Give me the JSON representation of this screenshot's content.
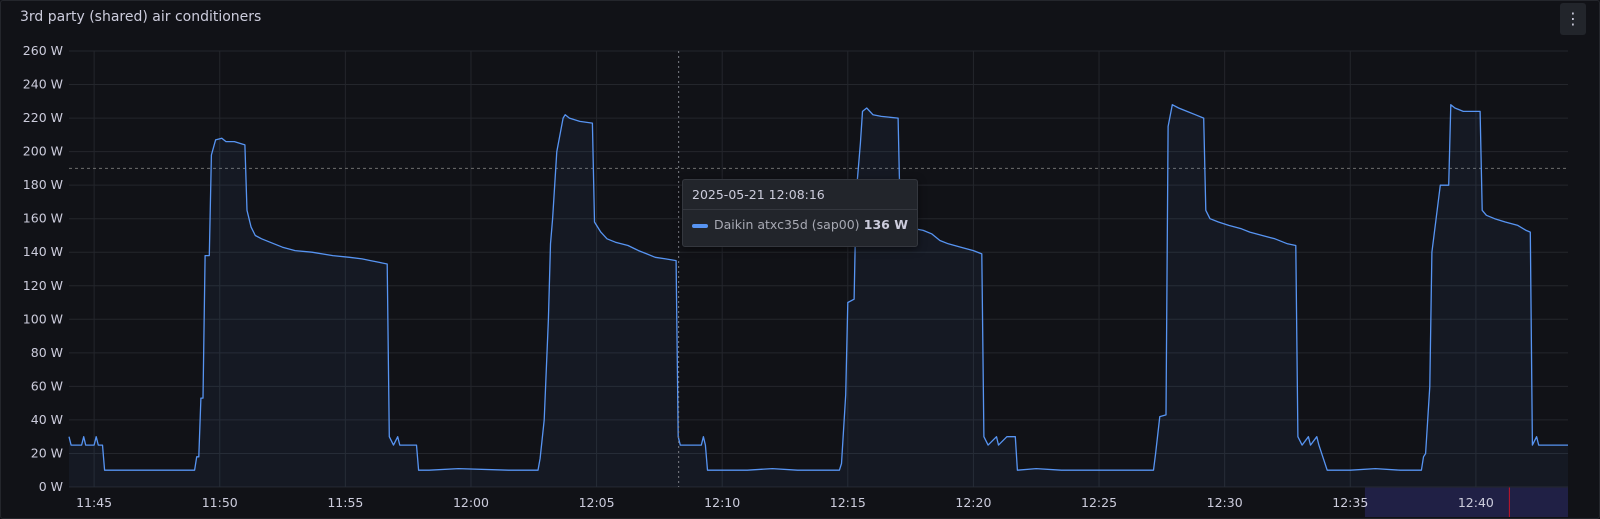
{
  "panel": {
    "title": "3rd party (shared) air conditioners",
    "menu_icon": "⋮"
  },
  "tooltip": {
    "time": "2025-05-21 12:08:16",
    "series": "Daikin atxc35d (sap00)",
    "value": "136 W"
  },
  "colors": {
    "series": "#5794f2",
    "background": "#111217",
    "grid": "#24262c",
    "threshold": "#6e6e6e",
    "range_highlight": "#2e2b6b",
    "now_marker": "#c4162a"
  },
  "chart_data": {
    "type": "line",
    "title": "3rd party (shared) air conditioners",
    "xlabel": "",
    "ylabel": "",
    "ylim": [
      0,
      260
    ],
    "yticks": [
      "0 W",
      "20 W",
      "40 W",
      "60 W",
      "80 W",
      "100 W",
      "120 W",
      "140 W",
      "160 W",
      "180 W",
      "200 W",
      "220 W",
      "240 W",
      "260 W"
    ],
    "xticks": [
      "11:45",
      "11:50",
      "11:55",
      "12:00",
      "12:05",
      "12:10",
      "12:15",
      "12:20",
      "12:25",
      "12:30",
      "12:35",
      "12:40"
    ],
    "xlim": [
      "11:44:00",
      "12:43:40"
    ],
    "threshold": 190,
    "cursor_time": "12:08:16",
    "grid": true,
    "legend": "none",
    "series": [
      {
        "name": "Daikin atxc35d (sap00)",
        "fill": true,
        "points": [
          [
            "11:44:00",
            30
          ],
          [
            "11:44:05",
            25
          ],
          [
            "11:44:30",
            25
          ],
          [
            "11:44:35",
            30
          ],
          [
            "11:44:40",
            25
          ],
          [
            "11:45:00",
            25
          ],
          [
            "11:45:05",
            30
          ],
          [
            "11:45:10",
            25
          ],
          [
            "11:45:20",
            25
          ],
          [
            "11:45:25",
            10
          ],
          [
            "11:49:00",
            10
          ],
          [
            "11:49:05",
            18
          ],
          [
            "11:49:10",
            18
          ],
          [
            "11:49:15",
            53
          ],
          [
            "11:49:20",
            53
          ],
          [
            "11:49:25",
            138
          ],
          [
            "11:49:35",
            138
          ],
          [
            "11:49:40",
            198
          ],
          [
            "11:49:50",
            207
          ],
          [
            "11:50:05",
            208
          ],
          [
            "11:50:15",
            206
          ],
          [
            "11:50:35",
            206
          ],
          [
            "11:51:00",
            204
          ],
          [
            "11:51:05",
            165
          ],
          [
            "11:51:15",
            155
          ],
          [
            "11:51:25",
            150
          ],
          [
            "11:51:40",
            148
          ],
          [
            "11:52:00",
            146
          ],
          [
            "11:52:30",
            143
          ],
          [
            "11:53:00",
            141
          ],
          [
            "11:53:40",
            140
          ],
          [
            "11:54:30",
            138
          ],
          [
            "11:55:10",
            137
          ],
          [
            "11:55:40",
            136
          ],
          [
            "11:56:00",
            135
          ],
          [
            "11:56:20",
            134
          ],
          [
            "11:56:40",
            133
          ],
          [
            "11:56:45",
            30
          ],
          [
            "11:56:55",
            25
          ],
          [
            "11:57:05",
            30
          ],
          [
            "11:57:10",
            25
          ],
          [
            "11:57:50",
            25
          ],
          [
            "11:57:55",
            10
          ],
          [
            "11:58:20",
            10
          ],
          [
            "11:59:30",
            11
          ],
          [
            "12:01:30",
            10
          ],
          [
            "12:02:40",
            10
          ],
          [
            "12:02:45",
            17
          ],
          [
            "12:02:55",
            40
          ],
          [
            "12:03:05",
            100
          ],
          [
            "12:03:10",
            145
          ],
          [
            "12:03:15",
            160
          ],
          [
            "12:03:25",
            200
          ],
          [
            "12:03:40",
            220
          ],
          [
            "12:03:45",
            222
          ],
          [
            "12:03:55",
            220
          ],
          [
            "12:04:20",
            218
          ],
          [
            "12:04:50",
            217
          ],
          [
            "12:04:55",
            158
          ],
          [
            "12:05:10",
            152
          ],
          [
            "12:05:25",
            148
          ],
          [
            "12:05:45",
            146
          ],
          [
            "12:06:15",
            144
          ],
          [
            "12:06:40",
            141
          ],
          [
            "12:07:00",
            139
          ],
          [
            "12:07:20",
            137
          ],
          [
            "12:07:45",
            136
          ],
          [
            "12:08:10",
            135
          ],
          [
            "12:08:15",
            30
          ],
          [
            "12:08:20",
            25
          ],
          [
            "12:09:10",
            25
          ],
          [
            "12:09:15",
            30
          ],
          [
            "12:09:20",
            25
          ],
          [
            "12:09:25",
            10
          ],
          [
            "12:11:00",
            10
          ],
          [
            "12:12:00",
            11
          ],
          [
            "12:13:00",
            10
          ],
          [
            "12:14:40",
            10
          ],
          [
            "12:14:45",
            14
          ],
          [
            "12:14:55",
            55
          ],
          [
            "12:15:00",
            110
          ],
          [
            "12:15:15",
            112
          ],
          [
            "12:15:20",
            175
          ],
          [
            "12:15:25",
            190
          ],
          [
            "12:15:30",
            205
          ],
          [
            "12:15:35",
            224
          ],
          [
            "12:15:45",
            226
          ],
          [
            "12:16:00",
            222
          ],
          [
            "12:16:20",
            221
          ],
          [
            "12:17:00",
            220
          ],
          [
            "12:17:05",
            165
          ],
          [
            "12:17:10",
            158
          ],
          [
            "12:17:20",
            155
          ],
          [
            "12:17:40",
            154
          ],
          [
            "12:18:00",
            153
          ],
          [
            "12:18:20",
            151
          ],
          [
            "12:18:40",
            147
          ],
          [
            "12:19:00",
            145
          ],
          [
            "12:19:30",
            143
          ],
          [
            "12:20:00",
            141
          ],
          [
            "12:20:20",
            139
          ],
          [
            "12:20:25",
            30
          ],
          [
            "12:20:35",
            25
          ],
          [
            "12:20:55",
            30
          ],
          [
            "12:21:00",
            25
          ],
          [
            "12:21:20",
            30
          ],
          [
            "12:21:40",
            30
          ],
          [
            "12:21:45",
            10
          ],
          [
            "12:22:30",
            11
          ],
          [
            "12:23:30",
            10
          ],
          [
            "12:25:00",
            10
          ],
          [
            "12:26:00",
            10
          ],
          [
            "12:27:10",
            10
          ],
          [
            "12:27:15",
            20
          ],
          [
            "12:27:25",
            42
          ],
          [
            "12:27:40",
            43
          ],
          [
            "12:27:45",
            215
          ],
          [
            "12:27:55",
            228
          ],
          [
            "12:28:10",
            226
          ],
          [
            "12:28:30",
            224
          ],
          [
            "12:28:50",
            222
          ],
          [
            "12:29:10",
            220
          ],
          [
            "12:29:15",
            165
          ],
          [
            "12:29:25",
            160
          ],
          [
            "12:29:45",
            158
          ],
          [
            "12:30:10",
            156
          ],
          [
            "12:30:40",
            154
          ],
          [
            "12:31:00",
            152
          ],
          [
            "12:31:30",
            150
          ],
          [
            "12:32:00",
            148
          ],
          [
            "12:32:30",
            145
          ],
          [
            "12:32:50",
            144
          ],
          [
            "12:32:55",
            30
          ],
          [
            "12:33:05",
            25
          ],
          [
            "12:33:20",
            30
          ],
          [
            "12:33:25",
            25
          ],
          [
            "12:33:40",
            30
          ],
          [
            "12:33:45",
            25
          ],
          [
            "12:34:05",
            10
          ],
          [
            "12:35:00",
            10
          ],
          [
            "12:36:00",
            11
          ],
          [
            "12:37:00",
            10
          ],
          [
            "12:37:50",
            10
          ],
          [
            "12:37:55",
            18
          ],
          [
            "12:38:00",
            20
          ],
          [
            "12:38:10",
            60
          ],
          [
            "12:38:15",
            140
          ],
          [
            "12:38:25",
            160
          ],
          [
            "12:38:35",
            180
          ],
          [
            "12:38:55",
            180
          ],
          [
            "12:39:00",
            228
          ],
          [
            "12:39:10",
            226
          ],
          [
            "12:39:30",
            224
          ],
          [
            "12:40:10",
            224
          ],
          [
            "12:40:15",
            165
          ],
          [
            "12:40:25",
            162
          ],
          [
            "12:40:45",
            160
          ],
          [
            "12:41:10",
            158
          ],
          [
            "12:41:40",
            156
          ],
          [
            "12:42:00",
            153
          ],
          [
            "12:42:10",
            152
          ],
          [
            "12:42:15",
            25
          ],
          [
            "12:42:25",
            30
          ],
          [
            "12:42:30",
            25
          ],
          [
            "12:43:40",
            25
          ]
        ]
      }
    ]
  }
}
